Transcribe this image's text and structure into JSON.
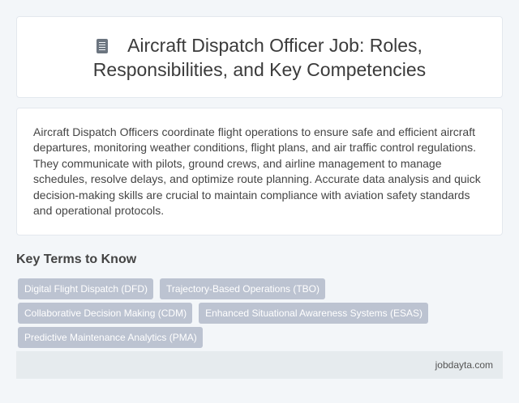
{
  "header": {
    "icon": "document-icon",
    "title": "Aircraft Dispatch Officer Job: Roles, Responsibilities, and Key Competencies"
  },
  "description": "Aircraft Dispatch Officers coordinate flight operations to ensure safe and efficient aircraft departures, monitoring weather conditions, flight plans, and air traffic control regulations. They communicate with pilots, ground crews, and airline management to manage schedules, resolve delays, and optimize route planning. Accurate data analysis and quick decision-making skills are crucial to maintain compliance with aviation safety standards and operational protocols.",
  "key_terms": {
    "heading": "Key Terms to Know",
    "tags": [
      "Digital Flight Dispatch (DFD)",
      "Trajectory-Based Operations (TBO)",
      "Collaborative Decision Making (CDM)",
      "Enhanced Situational Awareness Systems (ESAS)",
      "Predictive Maintenance Analytics (PMA)"
    ]
  },
  "footer": {
    "site": "jobdayta.com"
  },
  "colors": {
    "background": "#f3f6f9",
    "card": "#ffffff",
    "tag": "#bcc3d1",
    "footer": "#e6ebee"
  }
}
